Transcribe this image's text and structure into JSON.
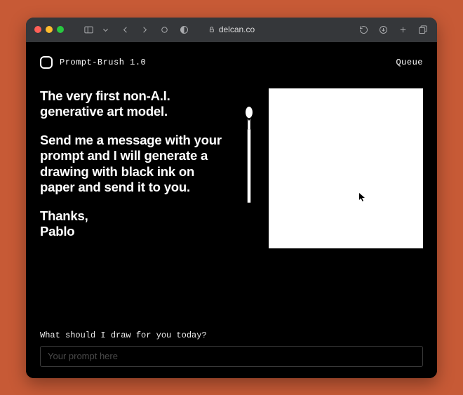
{
  "browser": {
    "url_host": "delcan.co"
  },
  "app": {
    "title": "Prompt-Brush 1.0",
    "nav": {
      "queue": "Queue"
    }
  },
  "hero": {
    "line1": "The very first non-A.I. generative art model.",
    "line2": "Send me a message with your prompt and I will generate a drawing with black ink on paper and send it to you.",
    "line3": "Thanks,",
    "line4": "Pablo"
  },
  "prompt": {
    "label": "What should I draw for you today?",
    "placeholder": "Your prompt here"
  }
}
